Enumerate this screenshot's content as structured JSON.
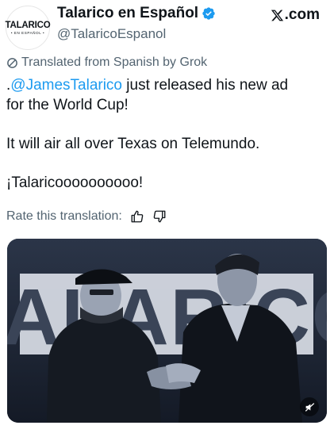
{
  "account": {
    "display_name": "Talarico en Español",
    "handle": "@TalaricoEspanol",
    "avatar_logo_main": "TALARICO",
    "avatar_logo_sub": "• EN ESPAÑOL •",
    "verified": true
  },
  "platform": {
    "logo_text": ".com"
  },
  "translation": {
    "notice": "Translated from Spanish by Grok",
    "rate_label": "Rate this translation:"
  },
  "tweet": {
    "line1_prefix": ".",
    "mention": "@JamesTalarico",
    "line1_rest": " just released his new ad",
    "line2": "for the World Cup!",
    "line3": "It will air all over Texas on Telemundo.",
    "line4": "¡Talaricoooooooooo!"
  },
  "media": {
    "backdrop_text": "TALARICO"
  },
  "colors": {
    "link": "#1d9bf0",
    "secondary_text": "#536471",
    "verified_badge": "#1d9bf0"
  },
  "icons": {
    "translate": "slashed-circle-icon",
    "thumbs_up": "thumbs-up-icon",
    "thumbs_down": "thumbs-down-icon",
    "mute": "speaker-muted-icon",
    "verified": "verified-badge-icon",
    "x_logo": "x-logo-icon"
  }
}
